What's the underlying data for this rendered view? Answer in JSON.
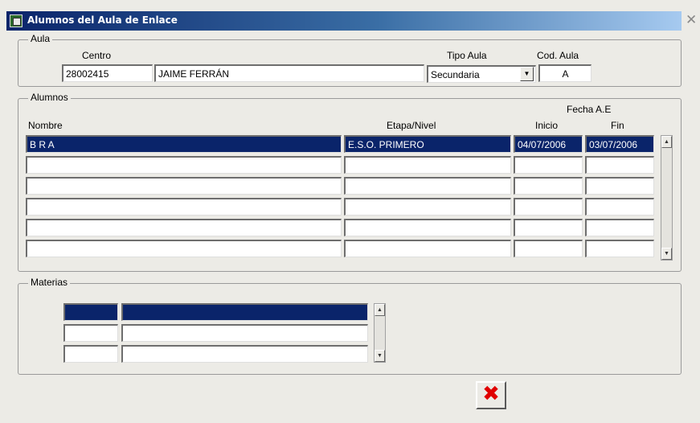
{
  "window": {
    "title": "Alumnos del Aula de Enlace",
    "close_glyph": "✕"
  },
  "aula": {
    "legend": "Aula",
    "centro_label": "Centro",
    "centro_code": "28002415",
    "centro_name": "JAIME FERRÁN",
    "tipo_label": "Tipo Aula",
    "tipo_value": "Secundaria",
    "cod_label": "Cod. Aula",
    "cod_value": "A"
  },
  "alumnos": {
    "legend": "Alumnos",
    "fecha_header": "Fecha A.E",
    "columns": [
      "Nombre",
      "Etapa/Nivel",
      "Inicio",
      "Fin"
    ],
    "rows": [
      {
        "nombre": "B R A",
        "etapa": "E.S.O. PRIMERO",
        "inicio": "04/07/2006",
        "fin": "03/07/2006",
        "selected": true
      },
      {
        "nombre": "",
        "etapa": "",
        "inicio": "",
        "fin": "",
        "selected": false
      },
      {
        "nombre": "",
        "etapa": "",
        "inicio": "",
        "fin": "",
        "selected": false
      },
      {
        "nombre": "",
        "etapa": "",
        "inicio": "",
        "fin": "",
        "selected": false
      },
      {
        "nombre": "",
        "etapa": "",
        "inicio": "",
        "fin": "",
        "selected": false
      },
      {
        "nombre": "",
        "etapa": "",
        "inicio": "",
        "fin": "",
        "selected": false
      }
    ]
  },
  "materias": {
    "legend": "Materias",
    "rows": [
      {
        "code": "",
        "name": "",
        "selected": true
      },
      {
        "code": "",
        "name": "",
        "selected": false
      },
      {
        "code": "",
        "name": "",
        "selected": false
      }
    ]
  },
  "icons": {
    "scroll_up": "▲",
    "scroll_down": "▼",
    "dropdown": "▼",
    "exit": "✖"
  },
  "colors": {
    "selection": "#0a246a",
    "exit_button": "#e00000"
  }
}
